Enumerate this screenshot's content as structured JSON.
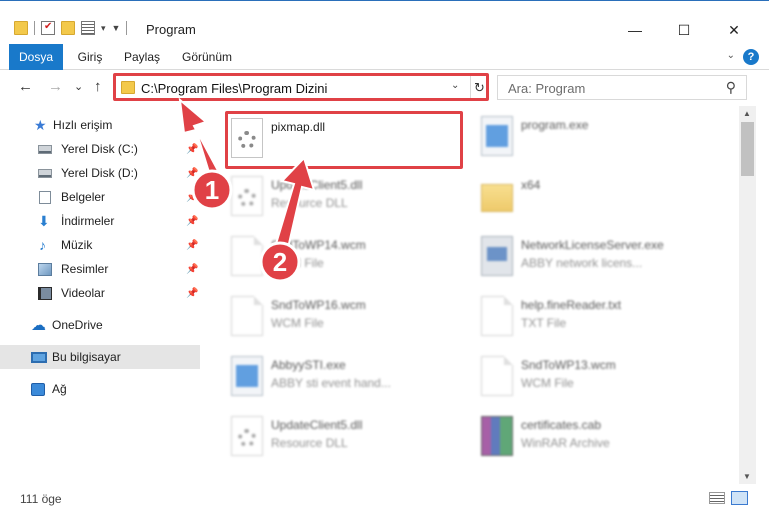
{
  "window": {
    "title": "Program",
    "minimize": "—",
    "maximize": "☐",
    "close": "✕"
  },
  "ribbon": {
    "tabs": [
      "Dosya",
      "Giriş",
      "Paylaş",
      "Görünüm"
    ],
    "help": "?"
  },
  "nav": {
    "back": "←",
    "forward": "→",
    "recent": "⌄",
    "up": "↑",
    "address": "C:\\Program Files\\Program Dizini",
    "refresh": "↻",
    "search_placeholder": "Ara: Program"
  },
  "sidebar": {
    "items": [
      {
        "label": "Hızlı erişim",
        "icon": "star-icon"
      },
      {
        "label": "Yerel Disk (C:)",
        "icon": "drive-icon",
        "pinned": true
      },
      {
        "label": "Yerel Disk (D:)",
        "icon": "drive-icon",
        "pinned": true
      },
      {
        "label": "Belgeler",
        "icon": "documents-icon",
        "pinned": true
      },
      {
        "label": "İndirmeler",
        "icon": "downloads-icon",
        "pinned": true
      },
      {
        "label": "Müzik",
        "icon": "music-icon",
        "pinned": true
      },
      {
        "label": "Resimler",
        "icon": "pictures-icon",
        "pinned": true
      },
      {
        "label": "Videolar",
        "icon": "videos-icon",
        "pinned": true
      },
      {
        "label": "OneDrive",
        "icon": "cloud-icon"
      },
      {
        "label": "Bu bilgisayar",
        "icon": "computer-icon",
        "selected": true
      },
      {
        "label": "Ağ",
        "icon": "network-icon"
      }
    ]
  },
  "files": [
    {
      "name": "pixmap.dll",
      "type": "",
      "icon": "dll-file-icon"
    },
    {
      "name": "program.exe",
      "type": "",
      "icon": "exe-file-icon"
    },
    {
      "name": "UpdateClient5.dll",
      "type": "Resource DLL",
      "icon": "dll-file-icon"
    },
    {
      "name": "x64",
      "type": "",
      "icon": "folder-icon"
    },
    {
      "name": "SndToWP14.wcm",
      "type": "WCM File",
      "icon": "document-file-icon"
    },
    {
      "name": "NetworkLicenseServer.exe",
      "type": "ABBY network licens...",
      "icon": "app-file-icon"
    },
    {
      "name": "SndToWP16.wcm",
      "type": "WCM File",
      "icon": "document-file-icon"
    },
    {
      "name": "help.fineReader.txt",
      "type": "TXT File",
      "icon": "document-file-icon"
    },
    {
      "name": "AbbyySTI.exe",
      "type": "ABBY sti event hand...",
      "icon": "exe-file-icon"
    },
    {
      "name": "SndToWP13.wcm",
      "type": "WCM File",
      "icon": "document-file-icon"
    },
    {
      "name": "UpdateClient5.dll",
      "type": "Resource DLL",
      "icon": "dll-file-icon"
    },
    {
      "name": "certificates.cab",
      "type": "WinRAR Archive",
      "icon": "archive-file-icon"
    }
  ],
  "status": {
    "item_count": "111 öge"
  },
  "annotations": {
    "step1": "1",
    "step2": "2",
    "highlight_color": "#e04146"
  }
}
